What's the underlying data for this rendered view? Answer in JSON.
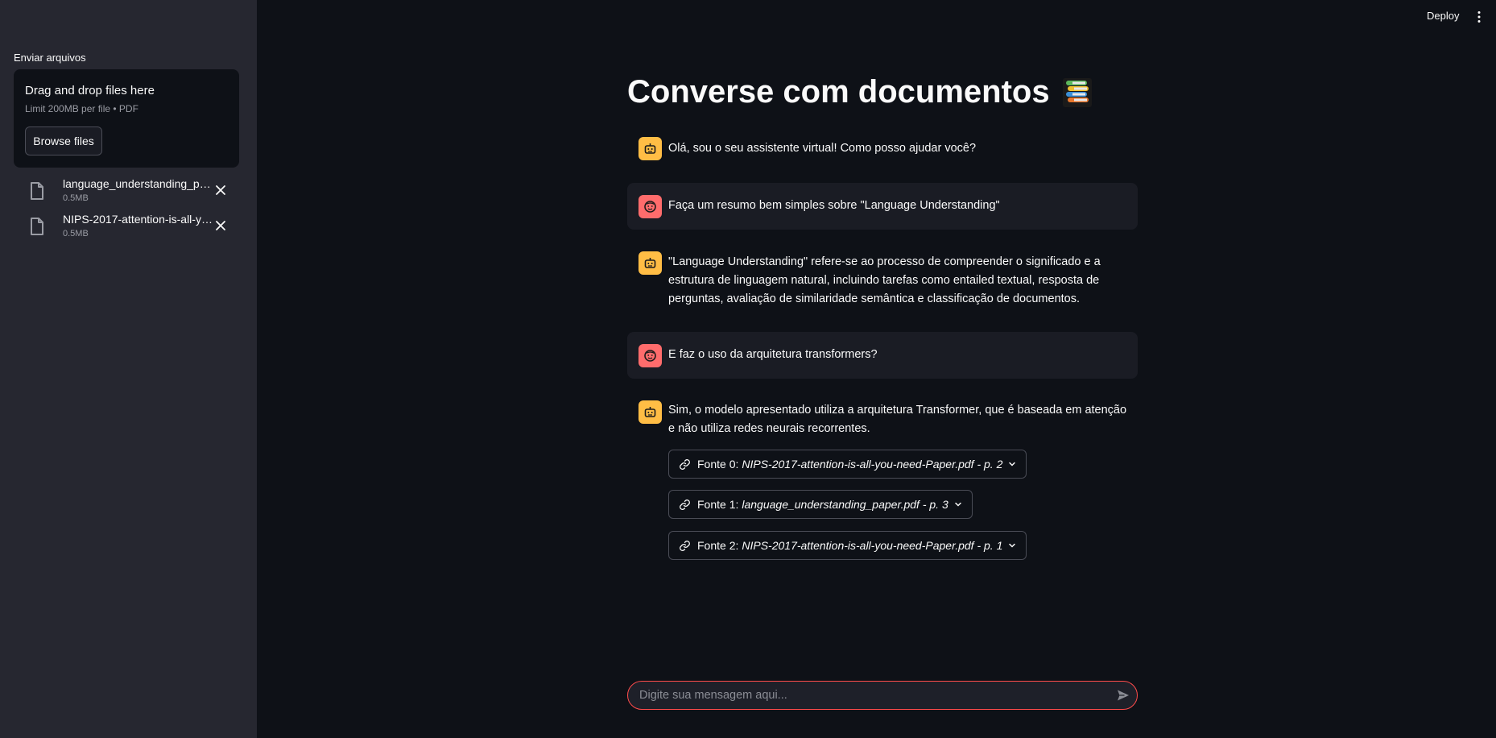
{
  "sidebar": {
    "upload_label": "Enviar arquivos",
    "dropzone": {
      "title": "Drag and drop files here",
      "subtitle": "Limit 200MB per file • PDF",
      "browse_label": "Browse files"
    },
    "files": [
      {
        "name": "language_understanding_paper.pdf",
        "size": "0.5MB"
      },
      {
        "name": "NIPS-2017-attention-is-all-you-need-Paper.pdf",
        "size": "0.5MB"
      }
    ]
  },
  "header": {
    "deploy_label": "Deploy"
  },
  "main": {
    "title": "Converse com documentos",
    "messages": [
      {
        "role": "assistant",
        "text": "Olá, sou o seu assistente virtual! Como posso ajudar você?"
      },
      {
        "role": "user",
        "text": "Faça um resumo bem simples sobre \"Language Understanding\""
      },
      {
        "role": "assistant",
        "text": "\"Language Understanding\" refere-se ao processo de compreender o significado e a estrutura de linguagem natural, incluindo tarefas como entailed textual, resposta de perguntas, avaliação de similaridade semântica e classificação de documentos."
      },
      {
        "role": "user",
        "text": "E faz o uso da arquitetura transformers?"
      },
      {
        "role": "assistant",
        "text": "Sim, o modelo apresentado utiliza a arquitetura Transformer, que é baseada em atenção e não utiliza redes neurais recorrentes."
      }
    ],
    "sources": [
      {
        "label": "Fonte 0:",
        "file": "NIPS-2017-attention-is-all-you-need-Paper.pdf - p. 2"
      },
      {
        "label": "Fonte 1:",
        "file": "language_understanding_paper.pdf - p. 3"
      },
      {
        "label": "Fonte 2:",
        "file": "NIPS-2017-attention-is-all-you-need-Paper.pdf - p. 1"
      }
    ],
    "chat_input": {
      "placeholder": "Digite sua mensagem aqui...",
      "value": ""
    }
  },
  "colors": {
    "background": "#0e1117",
    "sidebar": "#262730",
    "assistant_avatar": "#ffbd45",
    "user_avatar": "#ff6c6c",
    "accent": "#ff4b4b"
  },
  "icons": {
    "title_emoji": "books-icon",
    "file": "file-icon",
    "remove": "close-icon",
    "source": "link-icon",
    "expand": "chevron-down-icon",
    "send": "send-icon",
    "menu": "kebab-menu-icon",
    "assistant": "robot-icon",
    "user": "face-icon"
  }
}
